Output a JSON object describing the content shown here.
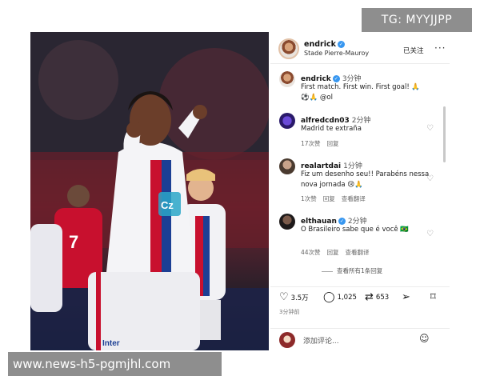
{
  "watermarks": {
    "top": "TG: MYYJJPP",
    "bottom": "www.news-h5-pgmjhl.com"
  },
  "post": {
    "username": "endrick",
    "location": "Stade Pierre-Mauroy",
    "follow_label": "已关注",
    "more_icon": "more-horizontal-icon",
    "caption": {
      "username": "endrick",
      "time": "3分钟",
      "text": "First match. First win. First goal! 🙏",
      "text2": "⚽🙏 @ol"
    },
    "photo": {
      "kit_text": "Cz",
      "sponsor_text": "Inter"
    }
  },
  "comments": [
    {
      "username": "alfredcdn03",
      "time": "2分钟",
      "text": "Madrid te extraña",
      "likes": "17次赞",
      "reply": "回复",
      "translate": ""
    },
    {
      "username": "realartdai",
      "time": "1分钟",
      "text": "Fiz um desenho seu!! Parabéns nessa nova jornada 😢🙏",
      "likes": "1次赞",
      "reply": "回复",
      "translate": "查看翻译"
    },
    {
      "username": "elthauan",
      "time": "2分钟",
      "text": "O Brasileiro sabe que é você 🇧🇷",
      "likes": "44次赞",
      "reply": "回复",
      "translate": "查看翻译"
    }
  ],
  "view_all_replies": "查看所有1条回复",
  "actions": {
    "likes": "3.5万",
    "comments": "1,025",
    "reposts": "653"
  },
  "time_ago": "3分钟前",
  "add_comment_placeholder": "添加评论...",
  "colors": {
    "verified": "#3897f0",
    "lyon_red": "#c8102e",
    "lyon_blue": "#1c3f94"
  }
}
